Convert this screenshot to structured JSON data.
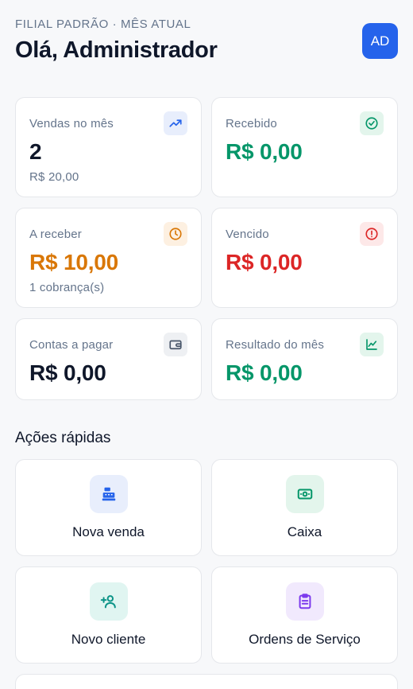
{
  "header": {
    "eyebrow": "FILIAL PADRÃO · MÊS ATUAL",
    "greeting": "Olá, Administrador",
    "avatar_initials": "AD"
  },
  "stats": [
    {
      "label": "Vendas no mês",
      "value": "2",
      "sub": "R$ 20,00",
      "icon": "trending-up-icon",
      "color": "#0f172a"
    },
    {
      "label": "Recebido",
      "value": "R$ 0,00",
      "sub": "",
      "icon": "check-circle-icon",
      "color": "#059669"
    },
    {
      "label": "A receber",
      "value": "R$ 10,00",
      "sub": "1 cobrança(s)",
      "icon": "clock-icon",
      "color": "#d97706"
    },
    {
      "label": "Vencido",
      "value": "R$ 0,00",
      "sub": "",
      "icon": "alert-circle-icon",
      "color": "#dc2626"
    },
    {
      "label": "Contas a pagar",
      "value": "R$ 0,00",
      "sub": "",
      "icon": "wallet-icon",
      "color": "#0f172a"
    },
    {
      "label": "Resultado do mês",
      "value": "R$ 0,00",
      "sub": "",
      "icon": "chart-line-icon",
      "color": "#059669"
    }
  ],
  "quick_actions": {
    "title": "Ações rápidas",
    "items": [
      {
        "label": "Nova venda",
        "icon": "cash-register-icon"
      },
      {
        "label": "Caixa",
        "icon": "cash-icon"
      },
      {
        "label": "Novo cliente",
        "icon": "user-plus-icon"
      },
      {
        "label": "Ordens de Serviço",
        "icon": "clipboard-icon"
      }
    ]
  }
}
